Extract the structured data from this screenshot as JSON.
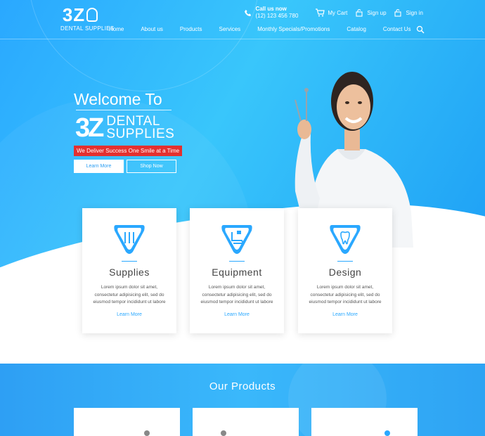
{
  "brand": {
    "logo_mark": "3Z",
    "logo_sub": "DENTAL SUPPLIES"
  },
  "topbar": {
    "call_label": "Call us now",
    "phone": "(12) 123 456 780",
    "cart": "My Cart",
    "signup": "Sign up",
    "signin": "Sign in"
  },
  "nav": {
    "items": [
      "Home",
      "About us",
      "Products",
      "Services",
      "Monthly Specials/Promotions",
      "Catalog",
      "Contact Us"
    ]
  },
  "hero": {
    "welcome": "Welcome To",
    "logo_mark": "3Z",
    "logo_line1": "DENTAL",
    "logo_line2": "SUPPLIES",
    "tagline": "We Deliver Success One Smile at a Time",
    "learn_more": "Learn More",
    "shop_now": "Shop Now"
  },
  "cards": [
    {
      "title": "Supplies",
      "desc": "Lorem ipsum dolor sit amet, consectetur adipisicing elit, sed do eiusmod tempor incididunt ut labore",
      "link": "Learn More",
      "icon": "dental-tools-icon"
    },
    {
      "title": "Equipment",
      "desc": "Lorem ipsum dolor sit amet, consectetur adipisicing elit, sed do eiusmod tempor incididunt ut labore",
      "link": "Learn More",
      "icon": "dental-chair-icon"
    },
    {
      "title": "Design",
      "desc": "Lorem ipsum dolor sit amet, consectetur adipisicing elit, sed do eiusmod tempor incididunt ut labore",
      "link": "Learn More",
      "icon": "tooth-icon"
    }
  ],
  "products": {
    "title": "Our Products"
  },
  "colors": {
    "accent": "#2aa8ff",
    "tagline_bg": "#e4302f"
  }
}
